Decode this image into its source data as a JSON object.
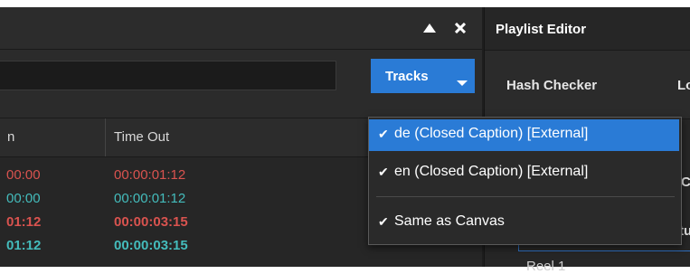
{
  "header": {
    "collapse_icon": "triangle-up",
    "close_icon": "x"
  },
  "search": {
    "value": "",
    "placeholder": ""
  },
  "tracks_button": {
    "label": "Tracks"
  },
  "table": {
    "columns": [
      {
        "label": "n"
      },
      {
        "label": "Time Out"
      }
    ],
    "rows": [
      {
        "time_in": "00:00",
        "time_out": "00:00:01:12",
        "color": "#d9534f",
        "bold": false
      },
      {
        "time_in": "00:00",
        "time_out": "00:00:01:12",
        "color": "#44bcbc",
        "bold": false
      },
      {
        "time_in": "01:12",
        "time_out": "00:00:03:15",
        "color": "#d9534f",
        "bold": true
      },
      {
        "time_in": "01:12",
        "time_out": "00:00:03:15",
        "color": "#44bcbc",
        "bold": true
      }
    ]
  },
  "playlist": {
    "title": "Playlist Editor",
    "tabs": [
      {
        "label": "Hash Checker"
      },
      {
        "label": "Lo"
      }
    ],
    "tree_item": "Reel 1",
    "fragments": [
      "C",
      "tu"
    ]
  },
  "dropdown": {
    "items": [
      {
        "label": "de (Closed Caption) [External]",
        "checked": true,
        "selected": true
      },
      {
        "label": "en (Closed Caption) [External]",
        "checked": true,
        "selected": false
      },
      {
        "label": "Same as Canvas",
        "checked": true,
        "selected": false
      }
    ],
    "check_glyph": "✔"
  },
  "colors": {
    "accent": "#2a7bd6",
    "red_text": "#d9534f",
    "cyan_text": "#44bcbc"
  }
}
